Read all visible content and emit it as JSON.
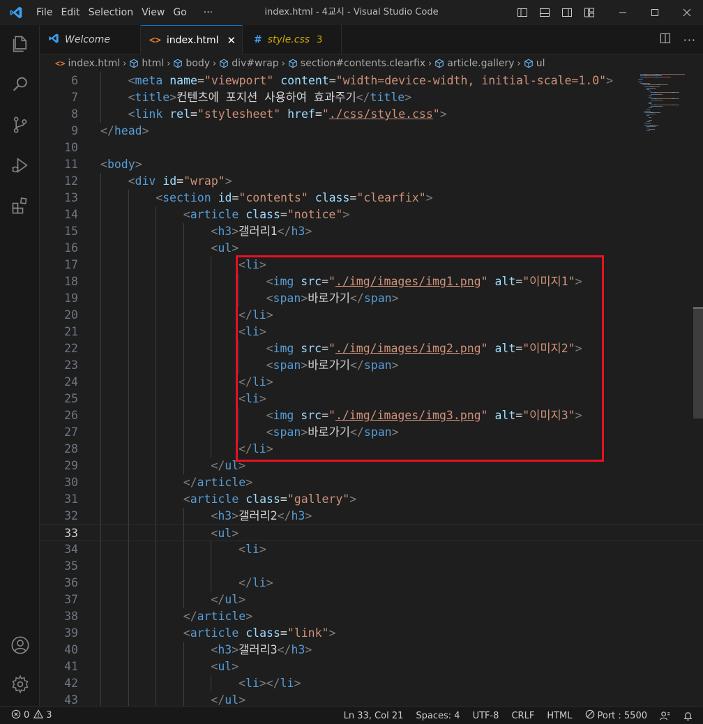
{
  "menu": {
    "items": [
      "File",
      "Edit",
      "Selection",
      "View",
      "Go",
      "···"
    ]
  },
  "window_title": "index.html - 4교시 - Visual Studio Code",
  "tabs": [
    {
      "label": "Welcome",
      "icon": "vscode-logo-icon"
    },
    {
      "label": "index.html",
      "icon": "html-icon",
      "close": "✕"
    },
    {
      "label": "style.css",
      "icon": "hash-icon",
      "icon_glyph": "#",
      "badge": "3"
    }
  ],
  "breadcrumbs": [
    "index.html",
    "html",
    "body",
    "div#wrap",
    "section#contents.clearfix",
    "article.gallery",
    "ul"
  ],
  "editor": {
    "lines": [
      {
        "n": "6",
        "indent": 1,
        "tokens": [
          [
            "p",
            "<"
          ],
          [
            "tag",
            "meta"
          ],
          [
            "t",
            " "
          ],
          [
            "attr",
            "name"
          ],
          [
            "t",
            "="
          ],
          [
            "str",
            "\"viewport\""
          ],
          [
            "t",
            " "
          ],
          [
            "attr",
            "content"
          ],
          [
            "t",
            "="
          ],
          [
            "str",
            "\"width=device-width, initial-scale=1.0\""
          ],
          [
            "p",
            ">"
          ]
        ]
      },
      {
        "n": "7",
        "indent": 1,
        "tokens": [
          [
            "p",
            "<"
          ],
          [
            "tag",
            "title"
          ],
          [
            "p",
            ">"
          ],
          [
            "t",
            "컨텐츠에 포지션 사용하여 효과주기"
          ],
          [
            "p",
            "</"
          ],
          [
            "tag",
            "title"
          ],
          [
            "p",
            ">"
          ]
        ]
      },
      {
        "n": "8",
        "indent": 1,
        "tokens": [
          [
            "p",
            "<"
          ],
          [
            "tag",
            "link"
          ],
          [
            "t",
            " "
          ],
          [
            "attr",
            "rel"
          ],
          [
            "t",
            "="
          ],
          [
            "str",
            "\"stylesheet\""
          ],
          [
            "t",
            " "
          ],
          [
            "attr",
            "href"
          ],
          [
            "t",
            "="
          ],
          [
            "str",
            "\""
          ],
          [
            "link",
            "./css/style.css"
          ],
          [
            "str",
            "\""
          ],
          [
            "p",
            ">"
          ]
        ]
      },
      {
        "n": "9",
        "indent": 0,
        "tokens": [
          [
            "p",
            "</"
          ],
          [
            "tag",
            "head"
          ],
          [
            "p",
            ">"
          ]
        ]
      },
      {
        "n": "10",
        "indent": 0,
        "tokens": []
      },
      {
        "n": "11",
        "indent": 0,
        "tokens": [
          [
            "p",
            "<"
          ],
          [
            "tag",
            "body"
          ],
          [
            "p",
            ">"
          ]
        ]
      },
      {
        "n": "12",
        "indent": 1,
        "tokens": [
          [
            "p",
            "<"
          ],
          [
            "tag",
            "div"
          ],
          [
            "t",
            " "
          ],
          [
            "attr",
            "id"
          ],
          [
            "t",
            "="
          ],
          [
            "str",
            "\"wrap\""
          ],
          [
            "p",
            ">"
          ]
        ]
      },
      {
        "n": "13",
        "indent": 2,
        "tokens": [
          [
            "p",
            "<"
          ],
          [
            "tag",
            "section"
          ],
          [
            "t",
            " "
          ],
          [
            "attr",
            "id"
          ],
          [
            "t",
            "="
          ],
          [
            "str",
            "\"contents\""
          ],
          [
            "t",
            " "
          ],
          [
            "attr",
            "class"
          ],
          [
            "t",
            "="
          ],
          [
            "str",
            "\"clearfix\""
          ],
          [
            "p",
            ">"
          ]
        ]
      },
      {
        "n": "14",
        "indent": 3,
        "tokens": [
          [
            "p",
            "<"
          ],
          [
            "tag",
            "article"
          ],
          [
            "t",
            " "
          ],
          [
            "attr",
            "class"
          ],
          [
            "t",
            "="
          ],
          [
            "str",
            "\"notice\""
          ],
          [
            "p",
            ">"
          ]
        ]
      },
      {
        "n": "15",
        "indent": 4,
        "tokens": [
          [
            "p",
            "<"
          ],
          [
            "tag",
            "h3"
          ],
          [
            "p",
            ">"
          ],
          [
            "t",
            "갤러리1"
          ],
          [
            "p",
            "</"
          ],
          [
            "tag",
            "h3"
          ],
          [
            "p",
            ">"
          ]
        ]
      },
      {
        "n": "16",
        "indent": 4,
        "tokens": [
          [
            "p",
            "<"
          ],
          [
            "tag",
            "ul"
          ],
          [
            "p",
            ">"
          ]
        ]
      },
      {
        "n": "17",
        "indent": 5,
        "tokens": [
          [
            "p",
            "<"
          ],
          [
            "tag",
            "li"
          ],
          [
            "p",
            ">"
          ]
        ]
      },
      {
        "n": "18",
        "indent": 6,
        "tokens": [
          [
            "p",
            "<"
          ],
          [
            "tag",
            "img"
          ],
          [
            "t",
            " "
          ],
          [
            "attr",
            "src"
          ],
          [
            "t",
            "="
          ],
          [
            "str",
            "\""
          ],
          [
            "link",
            "./img/images/img1.png"
          ],
          [
            "str",
            "\""
          ],
          [
            "t",
            " "
          ],
          [
            "attr",
            "alt"
          ],
          [
            "t",
            "="
          ],
          [
            "str",
            "\"이미지1\""
          ],
          [
            "p",
            ">"
          ]
        ]
      },
      {
        "n": "19",
        "indent": 6,
        "tokens": [
          [
            "p",
            "<"
          ],
          [
            "tag",
            "span"
          ],
          [
            "p",
            ">"
          ],
          [
            "t",
            "바로가기"
          ],
          [
            "p",
            "</"
          ],
          [
            "tag",
            "span"
          ],
          [
            "p",
            ">"
          ]
        ]
      },
      {
        "n": "20",
        "indent": 5,
        "tokens": [
          [
            "p",
            "</"
          ],
          [
            "tag",
            "li"
          ],
          [
            "p",
            ">"
          ]
        ]
      },
      {
        "n": "21",
        "indent": 5,
        "tokens": [
          [
            "p",
            "<"
          ],
          [
            "tag",
            "li"
          ],
          [
            "p",
            ">"
          ]
        ]
      },
      {
        "n": "22",
        "indent": 6,
        "tokens": [
          [
            "p",
            "<"
          ],
          [
            "tag",
            "img"
          ],
          [
            "t",
            " "
          ],
          [
            "attr",
            "src"
          ],
          [
            "t",
            "="
          ],
          [
            "str",
            "\""
          ],
          [
            "link",
            "./img/images/img2.png"
          ],
          [
            "str",
            "\""
          ],
          [
            "t",
            " "
          ],
          [
            "attr",
            "alt"
          ],
          [
            "t",
            "="
          ],
          [
            "str",
            "\"이미지2\""
          ],
          [
            "p",
            ">"
          ]
        ]
      },
      {
        "n": "23",
        "indent": 6,
        "tokens": [
          [
            "p",
            "<"
          ],
          [
            "tag",
            "span"
          ],
          [
            "p",
            ">"
          ],
          [
            "t",
            "바로가기"
          ],
          [
            "p",
            "</"
          ],
          [
            "tag",
            "span"
          ],
          [
            "p",
            ">"
          ]
        ]
      },
      {
        "n": "24",
        "indent": 5,
        "tokens": [
          [
            "p",
            "</"
          ],
          [
            "tag",
            "li"
          ],
          [
            "p",
            ">"
          ]
        ]
      },
      {
        "n": "25",
        "indent": 5,
        "tokens": [
          [
            "p",
            "<"
          ],
          [
            "tag",
            "li"
          ],
          [
            "p",
            ">"
          ]
        ]
      },
      {
        "n": "26",
        "indent": 6,
        "tokens": [
          [
            "p",
            "<"
          ],
          [
            "tag",
            "img"
          ],
          [
            "t",
            " "
          ],
          [
            "attr",
            "src"
          ],
          [
            "t",
            "="
          ],
          [
            "str",
            "\""
          ],
          [
            "link",
            "./img/images/img3.png"
          ],
          [
            "str",
            "\""
          ],
          [
            "t",
            " "
          ],
          [
            "attr",
            "alt"
          ],
          [
            "t",
            "="
          ],
          [
            "str",
            "\"이미지3\""
          ],
          [
            "p",
            ">"
          ]
        ]
      },
      {
        "n": "27",
        "indent": 6,
        "tokens": [
          [
            "p",
            "<"
          ],
          [
            "tag",
            "span"
          ],
          [
            "p",
            ">"
          ],
          [
            "t",
            "바로가기"
          ],
          [
            "p",
            "</"
          ],
          [
            "tag",
            "span"
          ],
          [
            "p",
            ">"
          ]
        ]
      },
      {
        "n": "28",
        "indent": 5,
        "tokens": [
          [
            "p",
            "</"
          ],
          [
            "tag",
            "li"
          ],
          [
            "p",
            ">"
          ]
        ]
      },
      {
        "n": "29",
        "indent": 4,
        "tokens": [
          [
            "p",
            "</"
          ],
          [
            "tag",
            "ul"
          ],
          [
            "p",
            ">"
          ]
        ]
      },
      {
        "n": "30",
        "indent": 3,
        "tokens": [
          [
            "p",
            "</"
          ],
          [
            "tag",
            "article"
          ],
          [
            "p",
            ">"
          ]
        ]
      },
      {
        "n": "31",
        "indent": 3,
        "tokens": [
          [
            "p",
            "<"
          ],
          [
            "tag",
            "article"
          ],
          [
            "t",
            " "
          ],
          [
            "attr",
            "class"
          ],
          [
            "t",
            "="
          ],
          [
            "str",
            "\"gallery\""
          ],
          [
            "p",
            ">"
          ]
        ]
      },
      {
        "n": "32",
        "indent": 4,
        "tokens": [
          [
            "p",
            "<"
          ],
          [
            "tag",
            "h3"
          ],
          [
            "p",
            ">"
          ],
          [
            "t",
            "갤러리2"
          ],
          [
            "p",
            "</"
          ],
          [
            "tag",
            "h3"
          ],
          [
            "p",
            ">"
          ]
        ]
      },
      {
        "n": "33",
        "indent": 4,
        "current": true,
        "tokens": [
          [
            "p",
            "<"
          ],
          [
            "tag",
            "ul"
          ],
          [
            "p",
            ">"
          ]
        ]
      },
      {
        "n": "34",
        "indent": 5,
        "tokens": [
          [
            "p",
            "<"
          ],
          [
            "tag",
            "li"
          ],
          [
            "p",
            ">"
          ]
        ]
      },
      {
        "n": "35",
        "indent": 5,
        "tokens": []
      },
      {
        "n": "36",
        "indent": 5,
        "tokens": [
          [
            "p",
            "</"
          ],
          [
            "tag",
            "li"
          ],
          [
            "p",
            ">"
          ]
        ]
      },
      {
        "n": "37",
        "indent": 4,
        "tokens": [
          [
            "p",
            "</"
          ],
          [
            "tag",
            "ul"
          ],
          [
            "p",
            ">"
          ]
        ]
      },
      {
        "n": "38",
        "indent": 3,
        "tokens": [
          [
            "p",
            "</"
          ],
          [
            "tag",
            "article"
          ],
          [
            "p",
            ">"
          ]
        ]
      },
      {
        "n": "39",
        "indent": 3,
        "tokens": [
          [
            "p",
            "<"
          ],
          [
            "tag",
            "article"
          ],
          [
            "t",
            " "
          ],
          [
            "attr",
            "class"
          ],
          [
            "t",
            "="
          ],
          [
            "str",
            "\"link\""
          ],
          [
            "p",
            ">"
          ]
        ]
      },
      {
        "n": "40",
        "indent": 4,
        "tokens": [
          [
            "p",
            "<"
          ],
          [
            "tag",
            "h3"
          ],
          [
            "p",
            ">"
          ],
          [
            "t",
            "갤러리3"
          ],
          [
            "p",
            "</"
          ],
          [
            "tag",
            "h3"
          ],
          [
            "p",
            ">"
          ]
        ]
      },
      {
        "n": "41",
        "indent": 4,
        "tokens": [
          [
            "p",
            "<"
          ],
          [
            "tag",
            "ul"
          ],
          [
            "p",
            ">"
          ]
        ]
      },
      {
        "n": "42",
        "indent": 5,
        "tokens": [
          [
            "p",
            "<"
          ],
          [
            "tag",
            "li"
          ],
          [
            "p",
            "></"
          ],
          [
            "tag",
            "li"
          ],
          [
            "p",
            ">"
          ]
        ]
      },
      {
        "n": "43",
        "indent": 4,
        "tokens": [
          [
            "p",
            "</"
          ],
          [
            "tag",
            "ul"
          ],
          [
            "p",
            ">"
          ]
        ]
      }
    ]
  },
  "status": {
    "errors": "0",
    "warnings": "3",
    "position": "Ln 33, Col 21",
    "spaces": "Spaces: 4",
    "encoding": "UTF-8",
    "eol": "CRLF",
    "language": "HTML",
    "port": "Port : 5500"
  },
  "colors": {
    "accent": "#0078d4",
    "highlight_box": "#e81123",
    "tag": "#569cd6",
    "attribute": "#9cdcfe",
    "string": "#ce9178"
  }
}
